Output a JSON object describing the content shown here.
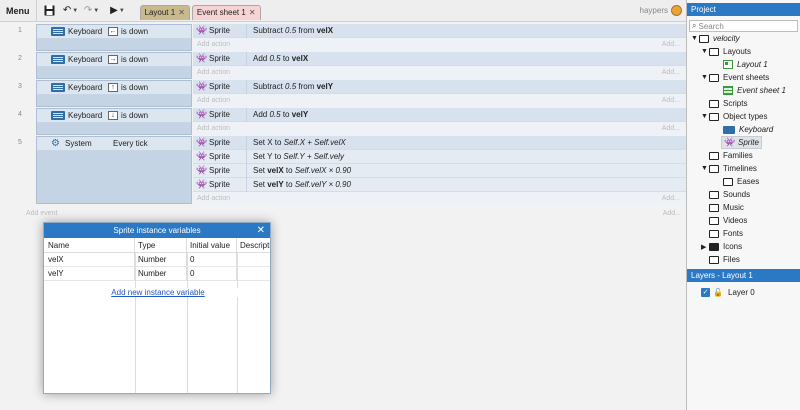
{
  "toolbar": {
    "menu_label": "Menu",
    "icons": [
      "save-icon",
      "undo-icon",
      "redo-icon",
      "play-icon"
    ],
    "tabs": [
      {
        "label": "Layout 1",
        "color": "#c9b98d"
      },
      {
        "label": "Event sheet 1",
        "color": "#f8d3d3"
      }
    ],
    "user": "haypers"
  },
  "events": [
    {
      "number": "1",
      "condition": {
        "object": "Keyboard",
        "key": "←",
        "text": "is down"
      },
      "actions": [
        {
          "object": "Sprite",
          "pre": "Subtract ",
          "italic": "0.5",
          "mid": " from ",
          "bold": "velX",
          "post": ""
        }
      ]
    },
    {
      "number": "2",
      "condition": {
        "object": "Keyboard",
        "key": "→",
        "text": "is down"
      },
      "actions": [
        {
          "object": "Sprite",
          "pre": "Add ",
          "italic": "0.5",
          "mid": " to ",
          "bold": "velX",
          "post": ""
        }
      ]
    },
    {
      "number": "3",
      "condition": {
        "object": "Keyboard",
        "key": "↑",
        "text": "is down"
      },
      "actions": [
        {
          "object": "Sprite",
          "pre": "Subtract ",
          "italic": "0.5",
          "mid": " from ",
          "bold": "velY",
          "post": ""
        }
      ]
    },
    {
      "number": "4",
      "condition": {
        "object": "Keyboard",
        "key": "↓",
        "text": "is down"
      },
      "actions": [
        {
          "object": "Sprite",
          "pre": "Add ",
          "italic": "0.5",
          "mid": " to ",
          "bold": "velY",
          "post": ""
        }
      ]
    },
    {
      "number": "5",
      "condition": {
        "object": "System",
        "key": "",
        "text": "Every tick"
      },
      "actions": [
        {
          "object": "Sprite",
          "pre": "Set X to ",
          "italic": "Self.X + Self.velX",
          "mid": "",
          "bold": "",
          "post": ""
        },
        {
          "object": "Sprite",
          "pre": "Set Y to ",
          "italic": "Self.Y + Self.vely",
          "mid": "",
          "bold": "",
          "post": ""
        },
        {
          "object": "Sprite",
          "pre": "Set ",
          "italic": "",
          "mid": "",
          "bold": "velX",
          "post2": " to ",
          "italic2": "Self.velX × 0.90"
        },
        {
          "object": "Sprite",
          "pre": "Set ",
          "italic": "",
          "mid": "",
          "bold": "velY",
          "post2": " to ",
          "italic2": "Self.velY × 0.90"
        }
      ]
    }
  ],
  "add_action_label": "Add action",
  "add_short": "Add...",
  "add_event_label": "Add event",
  "dialog": {
    "title": "Sprite instance variables",
    "columns": [
      "Name",
      "Type",
      "Initial value",
      "Description"
    ],
    "rows": [
      {
        "name": "velX",
        "type": "Number",
        "initial": "0"
      },
      {
        "name": "velY",
        "type": "Number",
        "initial": "0"
      }
    ],
    "add_link": "Add new instance variable"
  },
  "project": {
    "title": "Project",
    "search_placeholder": "Search",
    "root": "velocity",
    "layouts": "Layouts",
    "layout1": "Layout 1",
    "event_sheets": "Event sheets",
    "event_sheet1": "Event sheet 1",
    "scripts": "Scripts",
    "object_types": "Object types",
    "keyboard": "Keyboard",
    "sprite": "Sprite",
    "families": "Families",
    "timelines": "Timelines",
    "eases": "Eases",
    "sounds": "Sounds",
    "music": "Music",
    "videos": "Videos",
    "fonts": "Fonts",
    "icons": "Icons",
    "files": "Files"
  },
  "layers": {
    "title": "Layers - Layout 1",
    "layer0": "Layer 0"
  },
  "colors": {
    "accent": "#2b78c5",
    "condition_bg": "#dbe6f1",
    "action_bg": "#e4ebf3"
  }
}
